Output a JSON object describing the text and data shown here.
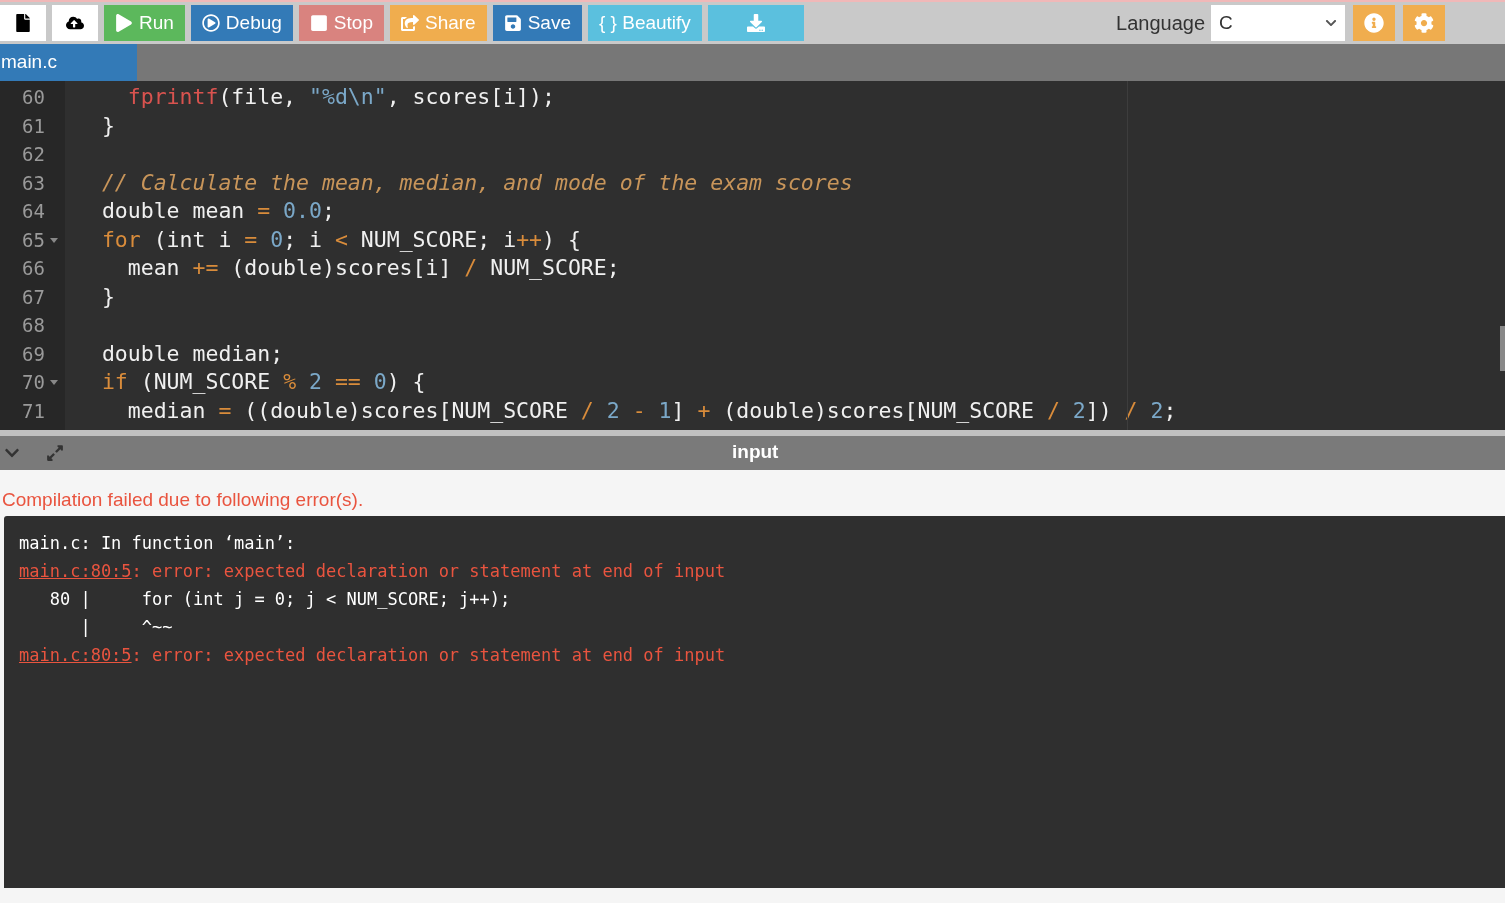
{
  "toolbar": {
    "buttons": [
      {
        "kind": "new-file",
        "color": "#ffffff"
      },
      {
        "kind": "upload",
        "color": "#ffffff"
      },
      {
        "kind": "run",
        "label": "Run",
        "color": "#5cb85c"
      },
      {
        "kind": "debug",
        "label": "Debug",
        "color": "#337ab7"
      },
      {
        "kind": "stop",
        "label": "Stop",
        "color": "#d9837f"
      },
      {
        "kind": "share",
        "label": "Share",
        "color": "#f0ad4e"
      },
      {
        "kind": "save",
        "label": "Save",
        "color": "#337ab7"
      },
      {
        "kind": "beautify",
        "label": "{ } Beautify",
        "color": "#5bc0de"
      },
      {
        "kind": "download",
        "color": "#5bc0de"
      }
    ],
    "language": {
      "label": "Language",
      "value": "C"
    },
    "right_buttons": [
      {
        "kind": "info"
      },
      {
        "kind": "settings"
      }
    ]
  },
  "tabs": [
    {
      "label": "main.c",
      "selected": true
    }
  ],
  "editor": {
    "lines": [
      {
        "number": "60",
        "foldable": false,
        "tokens": [
          {
            "kind": "func",
            "text": "    fprintf"
          },
          {
            "kind": "plain",
            "text": "(file, "
          },
          {
            "kind": "string",
            "text": "\"%d\\n\""
          },
          {
            "kind": "plain",
            "text": ", scores[i]);"
          }
        ]
      },
      {
        "number": "61",
        "foldable": false,
        "tokens": [
          {
            "kind": "plain",
            "text": "  }"
          }
        ]
      },
      {
        "number": "62",
        "foldable": false
      },
      {
        "number": "63",
        "foldable": false,
        "tokens": [
          {
            "kind": "comment",
            "text": "  // Calculate the mean, median, and mode of the exam scores"
          }
        ]
      },
      {
        "number": "64",
        "foldable": false,
        "tokens": [
          {
            "kind": "plain",
            "text": "  double mean "
          },
          {
            "kind": "operator",
            "text": "="
          },
          {
            "kind": "number",
            "text": " 0.0"
          },
          {
            "kind": "plain",
            "text": ";"
          }
        ]
      },
      {
        "number": "65",
        "foldable": true,
        "tokens": [
          {
            "kind": "keyword",
            "text": "  for"
          },
          {
            "kind": "plain",
            "text": " (int i "
          },
          {
            "kind": "operator",
            "text": "="
          },
          {
            "kind": "number",
            "text": " 0"
          },
          {
            "kind": "plain",
            "text": "; i "
          },
          {
            "kind": "operator",
            "text": "<"
          },
          {
            "kind": "plain",
            "text": " NUM_SCORE; i"
          },
          {
            "kind": "operator",
            "text": "++"
          },
          {
            "kind": "plain",
            "text": ") {"
          }
        ]
      },
      {
        "number": "66",
        "foldable": false,
        "tokens": [
          {
            "kind": "plain",
            "text": "    mean "
          },
          {
            "kind": "operator",
            "text": "+="
          },
          {
            "kind": "plain",
            "text": " (double)scores[i] "
          },
          {
            "kind": "operator",
            "text": "/"
          },
          {
            "kind": "plain",
            "text": " NUM_SCORE;"
          }
        ]
      },
      {
        "number": "67",
        "foldable": false,
        "tokens": [
          {
            "kind": "plain",
            "text": "  }"
          }
        ]
      },
      {
        "number": "68",
        "foldable": false
      },
      {
        "number": "69",
        "foldable": false,
        "tokens": [
          {
            "kind": "plain",
            "text": "  double median;"
          }
        ]
      },
      {
        "number": "70",
        "foldable": true,
        "tokens": [
          {
            "kind": "keyword",
            "text": "  if"
          },
          {
            "kind": "plain",
            "text": " (NUM_SCORE "
          },
          {
            "kind": "operator",
            "text": "%"
          },
          {
            "kind": "number",
            "text": " 2 "
          },
          {
            "kind": "operator",
            "text": "=="
          },
          {
            "kind": "number",
            "text": " 0"
          },
          {
            "kind": "plain",
            "text": ") {"
          }
        ]
      },
      {
        "number": "71",
        "foldable": false,
        "tokens": [
          {
            "kind": "plain",
            "text": "    median "
          },
          {
            "kind": "operator",
            "text": "="
          },
          {
            "kind": "plain",
            "text": " ((double)scores[NUM_SCORE "
          },
          {
            "kind": "operator",
            "text": "/"
          },
          {
            "kind": "number",
            "text": " 2 "
          },
          {
            "kind": "operator",
            "text": "-"
          },
          {
            "kind": "number",
            "text": " 1"
          },
          {
            "kind": "plain",
            "text": "] "
          },
          {
            "kind": "operator",
            "text": "+"
          },
          {
            "kind": "plain",
            "text": " (double)scores[NUM_SCORE "
          },
          {
            "kind": "operator",
            "text": "/"
          },
          {
            "kind": "number",
            "text": " 2"
          },
          {
            "kind": "plain",
            "text": "]) "
          },
          {
            "kind": "operator",
            "text": "/"
          },
          {
            "kind": "number",
            "text": " 2"
          },
          {
            "kind": "plain",
            "text": ";"
          }
        ]
      }
    ]
  },
  "panel": {
    "title": "input",
    "status": "Compilation failed due to following error(s).",
    "output": [
      {
        "segments": [
          {
            "kind": "plain",
            "text": "main.c: In function ‘main’:"
          }
        ]
      },
      {
        "segments": [
          {
            "kind": "link",
            "text": "main.c:80:5"
          },
          {
            "kind": "error",
            "text": ": error: expected declaration or statement at end of input"
          }
        ]
      },
      {
        "segments": [
          {
            "kind": "plain",
            "text": "   80 |     for (int j = 0; j < NUM_SCORE; j++);"
          }
        ]
      },
      {
        "segments": [
          {
            "kind": "plain",
            "text": "      |     ^~~"
          }
        ]
      },
      {
        "segments": [
          {
            "kind": "link",
            "text": "main.c:80:5"
          },
          {
            "kind": "error",
            "text": ": error: expected declaration or statement at end of input"
          }
        ]
      }
    ]
  }
}
